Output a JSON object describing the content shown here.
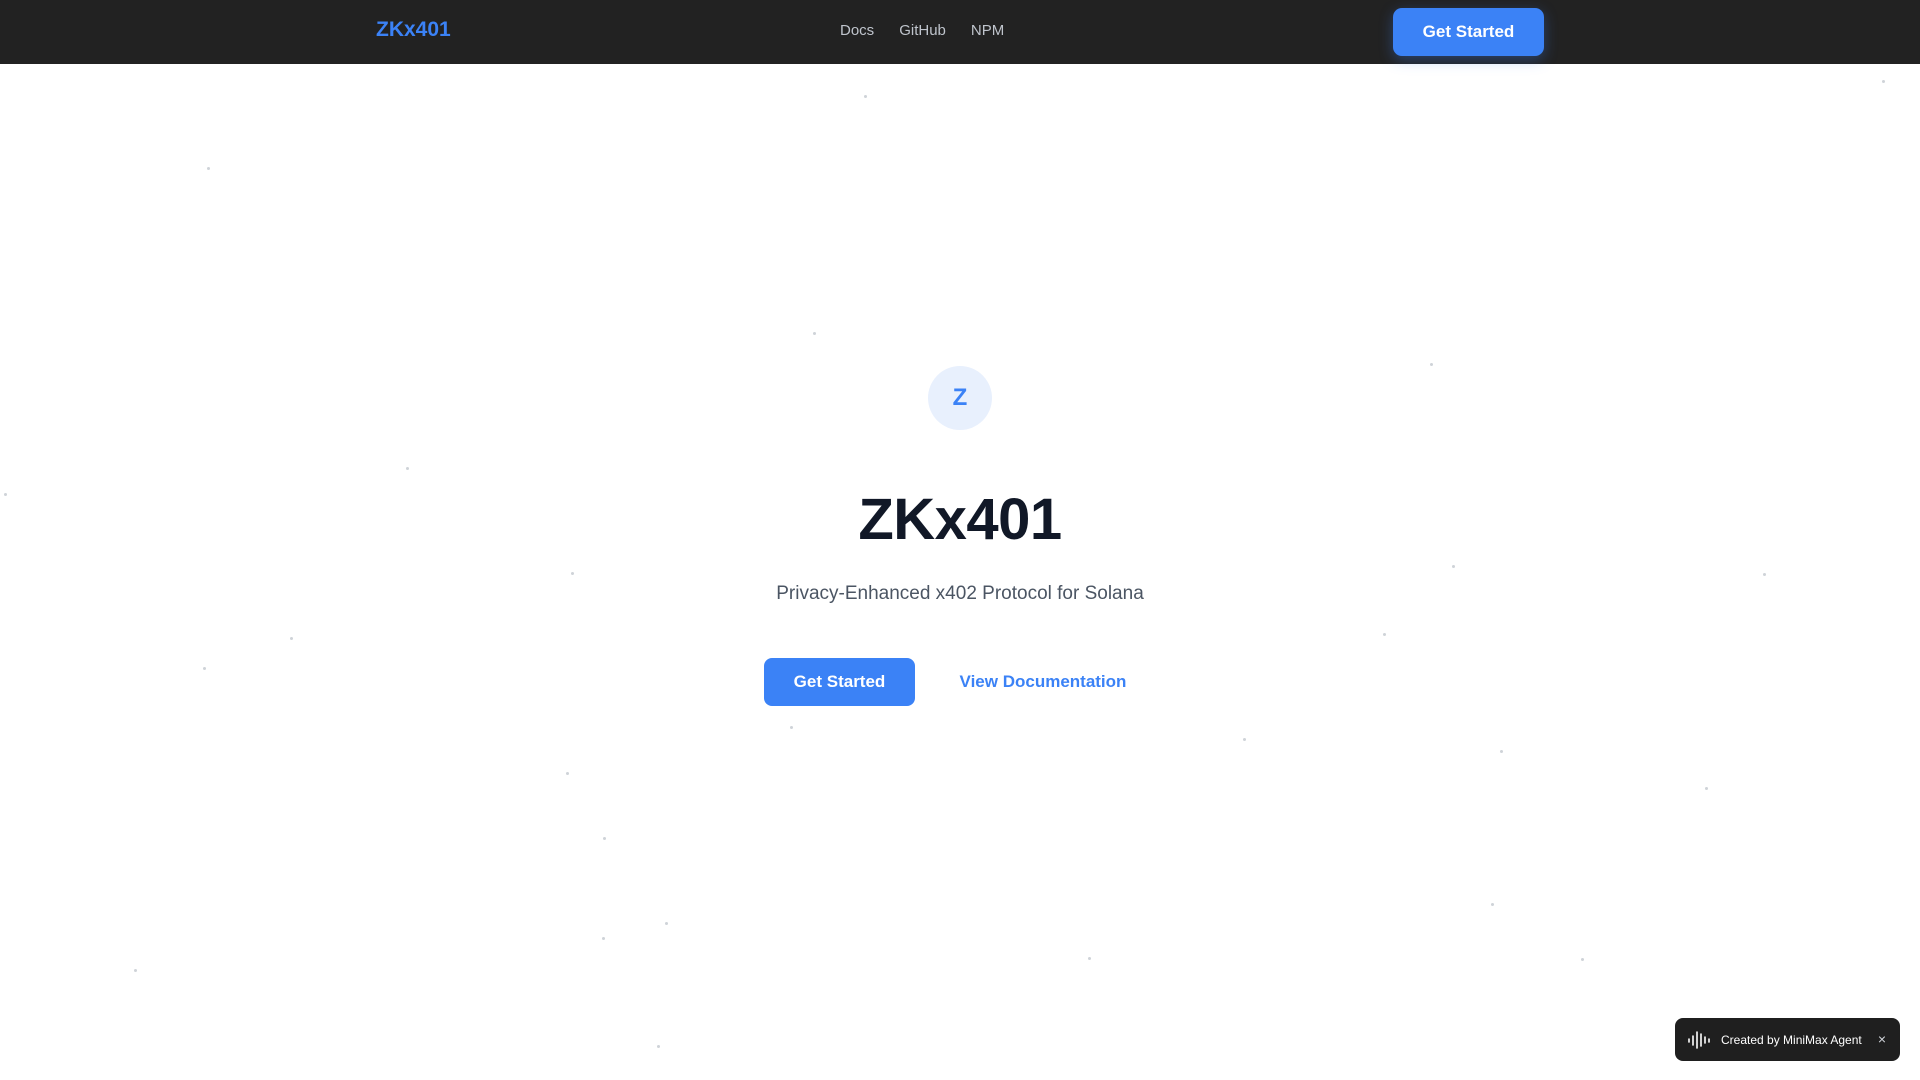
{
  "navbar": {
    "brand": "ZKx401",
    "links": [
      {
        "label": "Docs"
      },
      {
        "label": "GitHub"
      },
      {
        "label": "NPM"
      }
    ],
    "cta_label": "Get Started"
  },
  "hero": {
    "logo_letter": "Z",
    "title": "ZKx401",
    "subtitle": "Privacy-Enhanced x402 Protocol for Solana",
    "primary_label": "Get Started",
    "secondary_label": "View Documentation"
  },
  "badge": {
    "text": "Created by MiniMax Agent",
    "close": "×",
    "icon": "waveform-icon"
  },
  "colors": {
    "accent": "#3b82f6",
    "navbar_bg": "#222222",
    "title": "#111827",
    "subtitle": "#4b5563"
  }
}
